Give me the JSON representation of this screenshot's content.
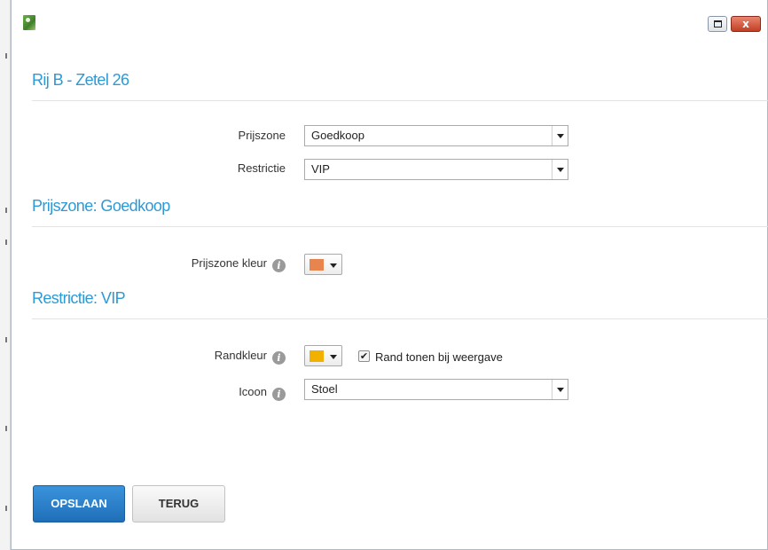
{
  "window": {
    "app_icon": "app-leaf-icon",
    "maximize_icon": "maximize-icon",
    "close_icon": "close-icon",
    "close_glyph": "x"
  },
  "header": {
    "title": "Rij B - Zetel 26"
  },
  "seat": {
    "prijszone_label": "Prijszone",
    "prijszone_value": "Goedkoop",
    "restrictie_label": "Restrictie",
    "restrictie_value": "VIP"
  },
  "prijszone_section": {
    "title": "Prijszone: Goedkoop",
    "kleur_label": "Prijszone kleur",
    "kleur_color": "#e8844e"
  },
  "restrictie_section": {
    "title": "Restrictie: VIP",
    "randkleur_label": "Randkleur",
    "randkleur_color": "#f2b100",
    "checkbox_label": "Rand tonen bij weergave",
    "checkbox_checked": true,
    "icoon_label": "Icoon",
    "icoon_value": "Stoel"
  },
  "actions": {
    "save_label": "OPSLAAN",
    "back_label": "TERUG"
  },
  "colors": {
    "accent": "#2c9ad6",
    "primary_button": "#2a80c8",
    "info_icon": "#9a9a9a"
  }
}
